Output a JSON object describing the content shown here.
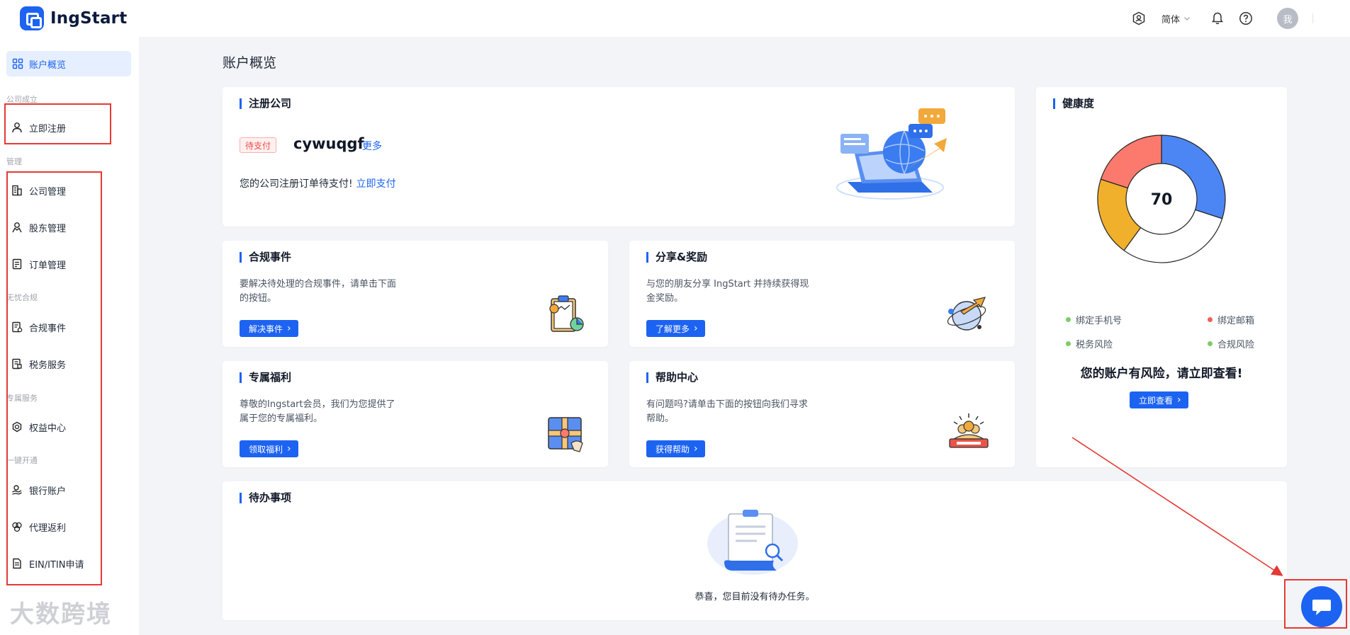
{
  "header": {
    "brand": "IngStart",
    "language": "简体",
    "avatar_label": "我"
  },
  "sidebar": {
    "overview": "账户概览",
    "group_company": "公司成立",
    "register": "立即注册",
    "group_manage": "管理",
    "company_manage": "公司管理",
    "shareholder_manage": "股东管理",
    "order_manage": "订单管理",
    "group_compliance": "无忧合规",
    "compliance_events": "合规事件",
    "tax_service": "税务服务",
    "group_exclusive": "专属服务",
    "benefit_center": "权益中心",
    "group_onekey": "一键开通",
    "bank_account": "银行账户",
    "agent_rebate": "代理返利",
    "ein_itin": "EIN/ITIN申请"
  },
  "watermark": "大数跨境",
  "main": {
    "page_title": "账户概览",
    "register_card": {
      "title": "注册公司",
      "status": "待支付",
      "company_name": "cywuqgf",
      "more": "更多",
      "note": "您的公司注册订单待支付!",
      "pay_link": "立即支付"
    },
    "compliance_card": {
      "title": "合规事件",
      "desc": "要解决待处理的合规事件，请单击下面的按钮。",
      "button": "解决事件"
    },
    "share_card": {
      "title": "分享&奖励",
      "desc": "与您的朋友分享 IngStart 并持续获得现金奖励。",
      "button": "了解更多"
    },
    "benefit_card": {
      "title": "专属福利",
      "desc": "尊敬的Ingstart会员，我们为您提供了属于您的专属福利。",
      "button": "领取福利"
    },
    "help_card": {
      "title": "帮助中心",
      "desc": "有问题吗?请单击下面的按钮向我们寻求帮助。",
      "button": "获得帮助"
    },
    "health_card": {
      "title": "健康度",
      "score": "70",
      "segments": [
        {
          "value": 0.3,
          "color": "#4c86f5"
        },
        {
          "value": 0.3,
          "color": "#ffffff"
        },
        {
          "value": 0.2,
          "color": "#f0b02c"
        },
        {
          "value": 0.2,
          "color": "#fb7a6d"
        }
      ],
      "legend": [
        {
          "label": "绑定手机号",
          "color": "#7dcc6a"
        },
        {
          "label": "绑定邮箱",
          "color": "#f0605a"
        },
        {
          "label": "税务风险",
          "color": "#7dcc6a"
        },
        {
          "label": "合规风险",
          "color": "#7dcc6a"
        }
      ],
      "risk_text": "您的账户有风险，请立即查看!",
      "button": "立即查看"
    },
    "todo_card": {
      "title": "待办事项",
      "empty_text": "恭喜，您目前没有待办任务。"
    }
  },
  "colors": {
    "primary": "#1d63f2",
    "annotation": "#e53935"
  }
}
